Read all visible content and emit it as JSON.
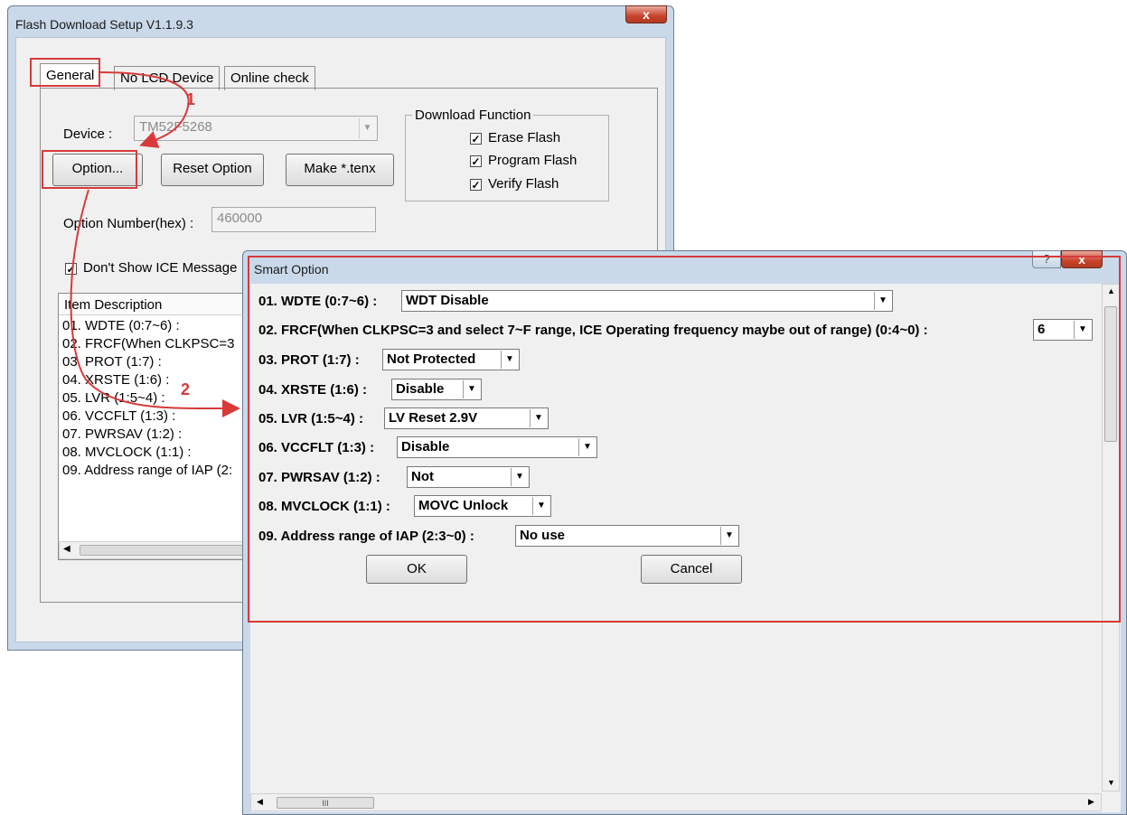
{
  "main_window": {
    "title": "Flash Download Setup V1.1.9.3",
    "close_label": "x",
    "tabs": [
      "General",
      "No LCD Device",
      "Online check"
    ],
    "device_label": "Device :",
    "device_value": "TM52F5268",
    "buttons": {
      "option": "Option...",
      "reset": "Reset Option",
      "make": "Make *.tenx"
    },
    "download_group": {
      "title": "Download Function",
      "items": [
        {
          "label": "Erase Flash",
          "checked": true
        },
        {
          "label": "Program Flash",
          "checked": true
        },
        {
          "label": "Verify Flash",
          "checked": true
        }
      ]
    },
    "option_number_label": "Option Number(hex) :",
    "option_number_value": "460000",
    "dont_show_label": "Don't Show ICE Message",
    "list_header": "Item Description",
    "list_items": [
      "01. WDTE (0:7~6) :",
      "02. FRCF(When CLKPSC=3",
      "03. PROT (1:7) :",
      "04. XRSTE (1:6) :",
      "05. LVR (1:5~4) :",
      "06. VCCFLT (1:3) :",
      "07. PWRSAV (1:2) :",
      "08. MVCLOCK (1:1) :",
      "09. Address range of IAP (2:"
    ]
  },
  "annotations": {
    "step1": "1",
    "step2": "2"
  },
  "smart_option": {
    "title": "Smart Option",
    "help_label": "?",
    "close_label": "x",
    "rows": [
      {
        "label": "01. WDTE (0:7~6) :",
        "value": "WDT Disable"
      },
      {
        "label": "02. FRCF(When CLKPSC=3 and select 7~F range, ICE Operating frequency maybe out of range) (0:4~0) :",
        "value": "6"
      },
      {
        "label": "03. PROT (1:7) :",
        "value": "Not Protected"
      },
      {
        "label": "04. XRSTE (1:6) :",
        "value": "Disable"
      },
      {
        "label": "05. LVR (1:5~4) :",
        "value": "LV Reset 2.9V"
      },
      {
        "label": "06. VCCFLT (1:3) :",
        "value": "Disable"
      },
      {
        "label": "07. PWRSAV (1:2) :",
        "value": "Not"
      },
      {
        "label": "08. MVCLOCK (1:1) :",
        "value": "MOVC Unlock"
      },
      {
        "label": "09. Address range of IAP (2:3~0)  :",
        "value": "No use"
      }
    ],
    "ok_label": "OK",
    "cancel_label": "Cancel",
    "hscroll_thumb": "III"
  },
  "colors": {
    "highlight_red": "#d83a3a",
    "window_frame": "#c9d9ea",
    "close_red": "#c7432a"
  }
}
